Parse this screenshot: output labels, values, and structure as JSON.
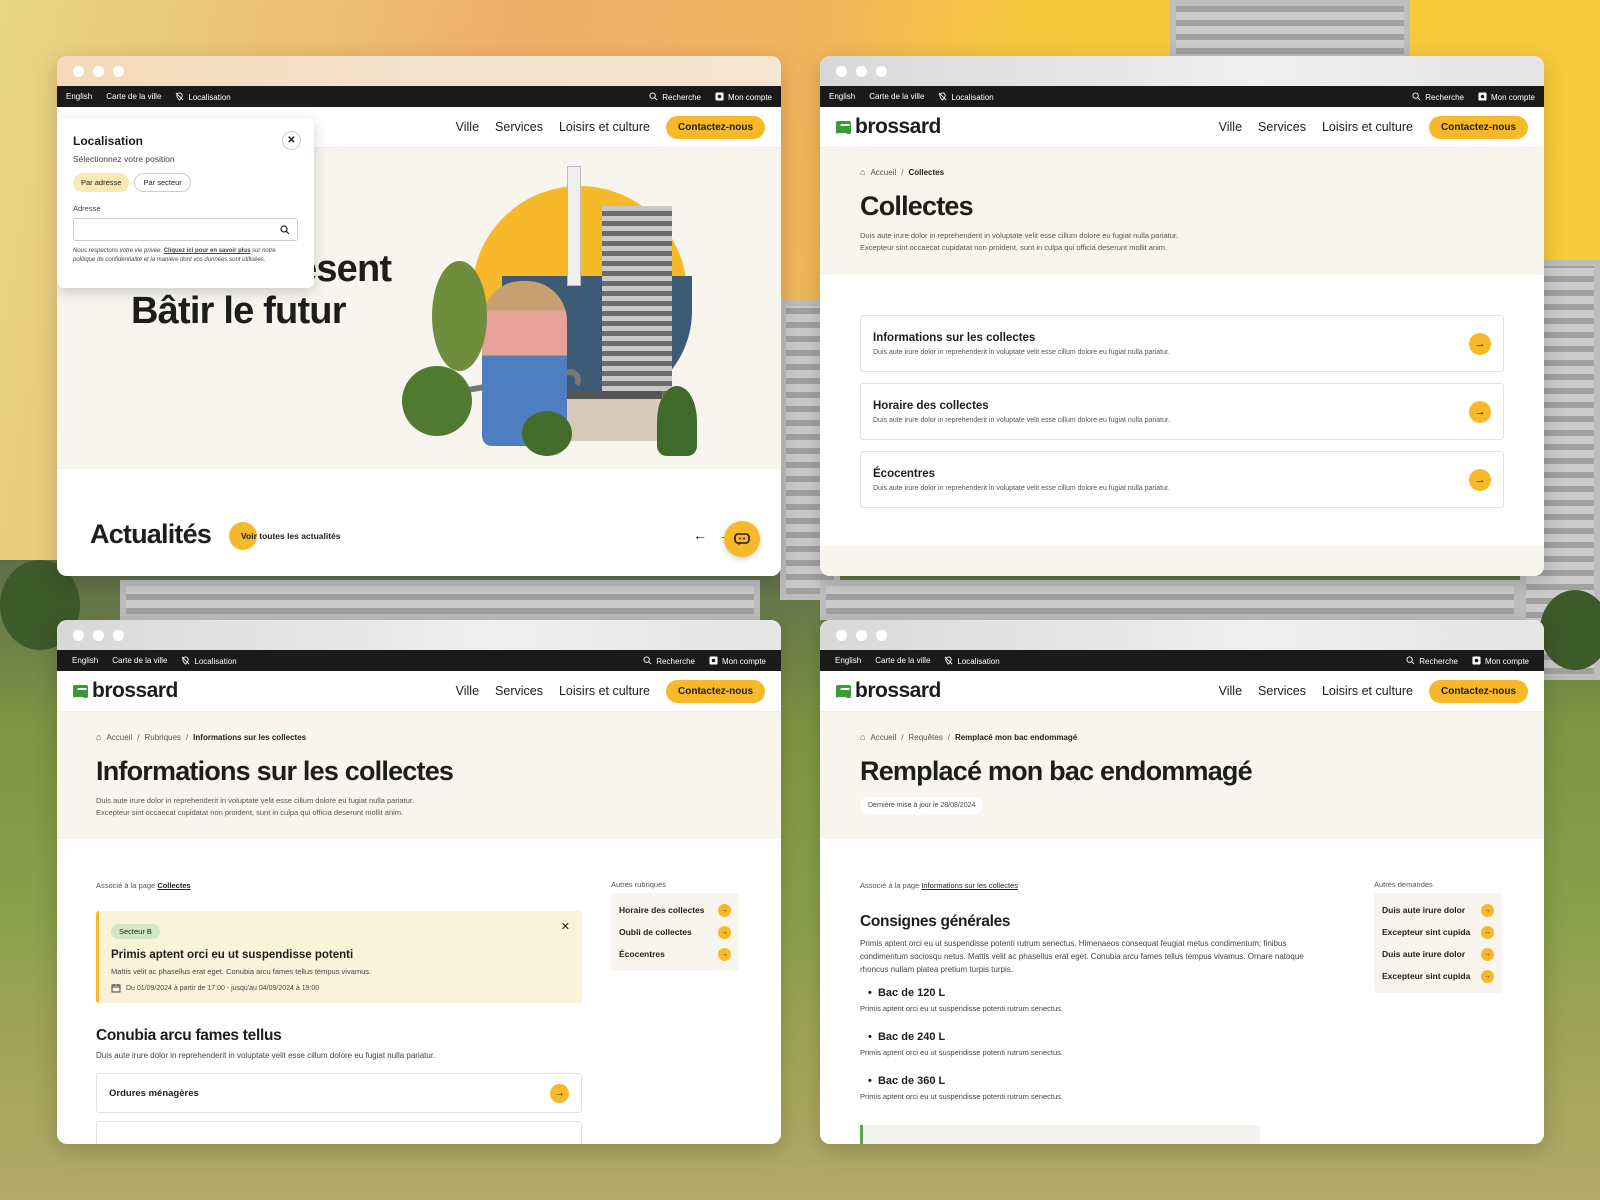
{
  "colors": {
    "accent": "#f7b82a",
    "dark": "#1a1a1a",
    "hero_bg": "#f7f5ee",
    "brand_green": "#3a9a3a"
  },
  "topbar": {
    "lang": "English",
    "map": "Carte de la ville",
    "location": "Localisation",
    "search": "Recherche",
    "account": "Mon compte"
  },
  "brand": {
    "name": "brossard"
  },
  "nav": {
    "ville": "Ville",
    "services": "Services",
    "loisirs": "Loisirs et culture",
    "contact": "Contactez-nous"
  },
  "w1": {
    "popup": {
      "title": "Localisation",
      "subtitle": "Sélectionnez votre position",
      "tab_address": "Par adresse",
      "tab_sector": "Par secteur",
      "field_label": "Adresse",
      "privacy_pre": "Nous respectons votre vie privée.",
      "privacy_link": "Cliquez ici pour en savoir plus",
      "privacy_post": "sur notre politique de confidentialité et la manière dont vos données sont utilisées."
    },
    "hero_line1": "ésent",
    "hero_line2": "Bâtir le futur",
    "news_title": "Actualités",
    "news_button": "Voir toutes les actualités"
  },
  "w2": {
    "crumb_home": "Accueil",
    "crumb_current": "Collectes",
    "title": "Collectes",
    "lede1": "Duis aute irure dolor in reprehenderit in voluptate velit esse cillum dolore eu fugiat nulla pariatur.",
    "lede2": "Excepteur sint occaecat cupidatat non proident, sunt in culpa qui officia deserunt mollit anim.",
    "cards": [
      {
        "title": "Informations sur les collectes",
        "desc": "Duis aute irure dolor in reprehenderit in voluptate velit esse cillum dolore eu fugiat nulla pariatur."
      },
      {
        "title": "Horaire des collectes",
        "desc": "Duis aute irure dolor in reprehenderit in voluptate velit esse cillum dolore eu fugiat nulla pariatur."
      },
      {
        "title": "Écocentres",
        "desc": "Duis aute irure dolor in reprehenderit in voluptate velit esse cillum dolore eu fugiat nulla pariatur."
      }
    ]
  },
  "w3": {
    "crumb_home": "Accueil",
    "crumb_mid": "Rubriques",
    "crumb_current": "Informations sur les collectes",
    "title": "Informations sur les collectes",
    "lede1": "Duis aute irure dolor in reprehenderit in voluptate velit esse cillum dolore eu fugiat nulla pariatur.",
    "lede2": "Excepteur sint occaecat cupidatat non proident, sunt in culpa qui officia deserunt mollit anim.",
    "assoc_pre": "Associé à la page",
    "assoc_link": "Collectes",
    "alert": {
      "badge": "Secteur B",
      "title": "Primis aptent orci eu ut suspendisse potenti",
      "text": "Mattis velit ac phasellus erat eget. Conubia arcu fames tellus tempus vivamus.",
      "date": "Du 01/09/2024 à partir de 17:00 - jusqu'au 04/09/2024 à 19:00"
    },
    "section_title": "Conubia arcu fames tellus",
    "section_text": "Duis aute irure dolor in reprehenderit in voluptate velit esse cillum dolore eu fugiat nulla pariatur.",
    "list_item": "Ordures ménagères",
    "side_title": "Autres rubriques",
    "side_items": [
      "Horaire des collectes",
      "Oubli de collectes",
      "Écocentres"
    ]
  },
  "w4": {
    "crumb_home": "Accueil",
    "crumb_mid": "Requêtes",
    "crumb_current": "Remplacé mon bac endommagé",
    "title": "Remplacé mon bac endommagé",
    "updated": "Dernière mise à jour le 28/08/2024",
    "assoc_pre": "Associé à la page",
    "assoc_link": "Informations sur les collectes",
    "section_title": "Consignes générales",
    "section_text": "Primis aptent orci eu ut suspendisse potenti rutrum senectus. Himenaeos consequat feugiat metus condimentum; finibus condimentum sociosqu netus. Mattis velit ac phasellus erat eget. Conubia arcu fames tellus tempus vivamus. Ornare natoque rhoncus nullam platea pretium turpis turpis.",
    "bins": [
      {
        "label": "Bac de 120 L",
        "text": "Primis aptent orci eu ut suspendisse potenti rutrum senectus."
      },
      {
        "label": "Bac de 240 L",
        "text": "Primis aptent orci eu ut suspendisse potenti rutrum senectus."
      },
      {
        "label": "Bac de 360 L",
        "text": "Primis aptent orci eu ut suspendisse potenti rutrum senectus."
      }
    ],
    "side_title": "Autres demandes",
    "side_items": [
      "Duis aute irure dolor",
      "Excepteur sint cupida",
      "Duis aute irure dolor",
      "Excepteur sint cupida"
    ]
  }
}
